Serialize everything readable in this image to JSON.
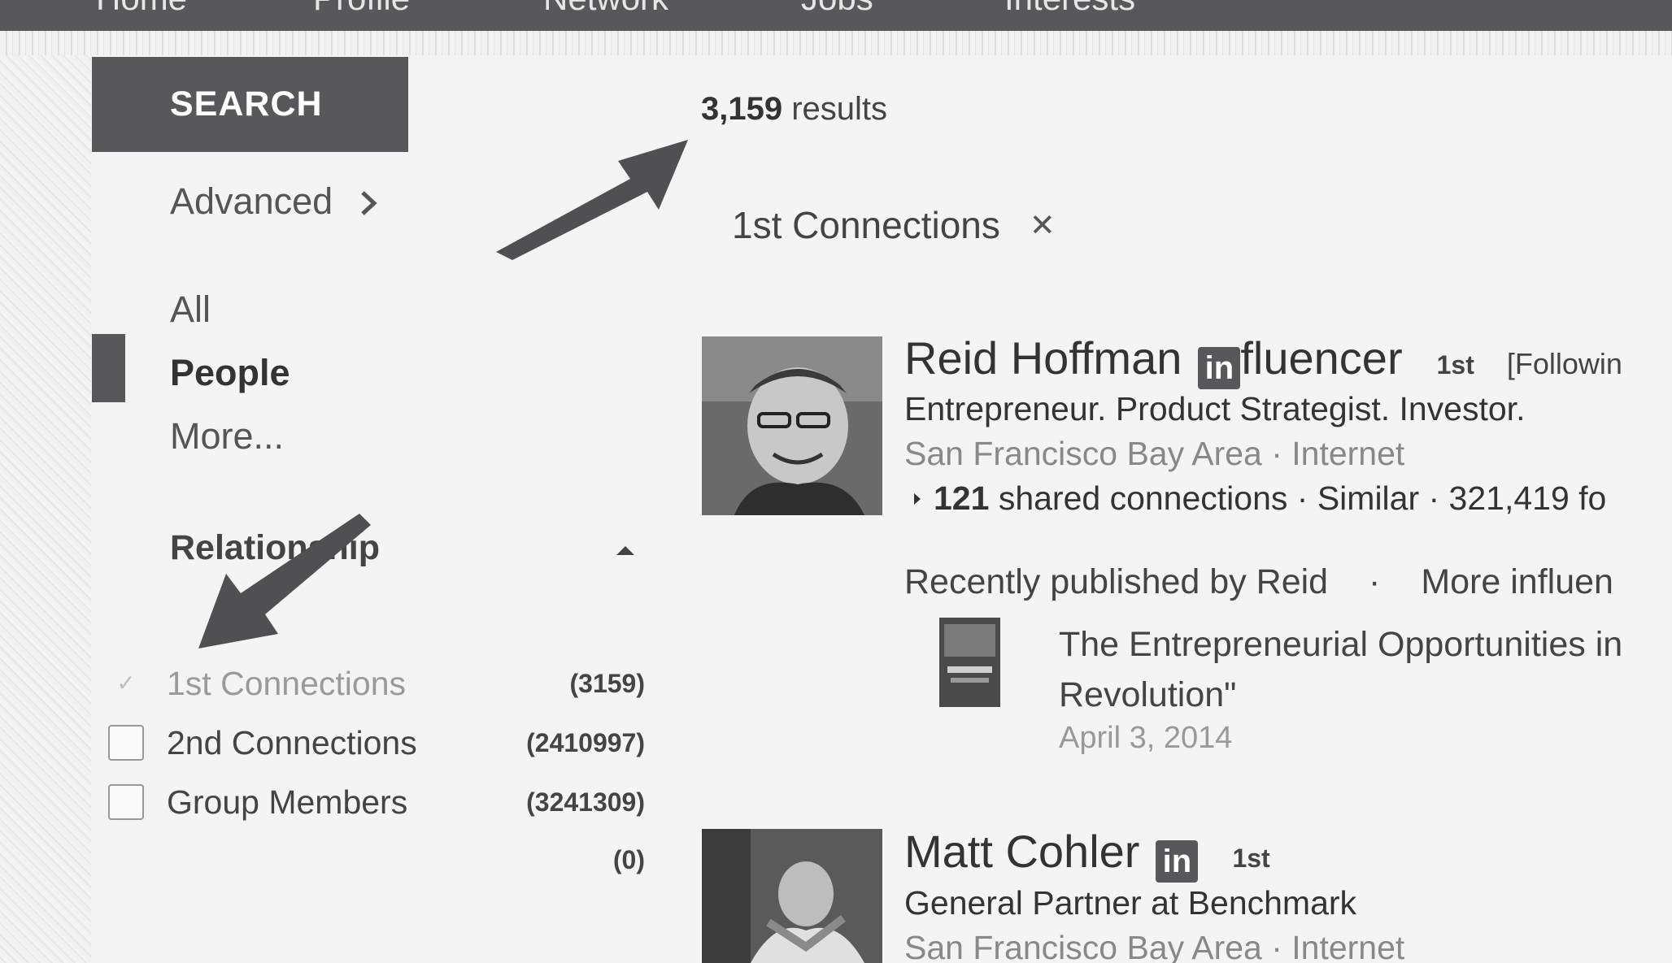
{
  "nav": {
    "items": [
      "Home",
      "Profile",
      "Network",
      "Jobs",
      "Interests"
    ]
  },
  "sidebar": {
    "search_label": "SEARCH",
    "advanced_label": "Advanced",
    "categories": [
      "All",
      "People",
      "More..."
    ],
    "relationship": {
      "title": "Relationship",
      "facets": [
        {
          "label": "1st Connections",
          "count": "(3159)",
          "checked": true
        },
        {
          "label": "2nd Connections",
          "count": "(2410997)",
          "checked": false
        },
        {
          "label": "Group Members",
          "count": "(3241309)",
          "checked": false
        }
      ],
      "extra_count": "(0)"
    }
  },
  "results": {
    "count": "3,159",
    "count_suffix": "results",
    "active_filter": "1st Connections",
    "people": [
      {
        "name": "Reid Hoffman",
        "influencer_badge": "in",
        "influencer_text": "fluencer",
        "degree": "1st",
        "following": "[Followin",
        "headline": "Entrepreneur. Product Strategist. Investor.",
        "location": "San Francisco Bay Area · Internet",
        "shared_count": "121",
        "shared_suffix": "shared connections · Similar · 321,419 fo",
        "recent_label": "Recently published by Reid",
        "recent_sep": "·",
        "more_influencers": "More influen",
        "article_title_line1": "The Entrepreneurial Opportunities in",
        "article_title_line2": "Revolution\"",
        "article_date": "April 3, 2014"
      },
      {
        "name": "Matt Cohler",
        "influencer_badge": "in",
        "degree": "1st",
        "headline": "General Partner at Benchmark",
        "location": "San Francisco Bay Area · Internet"
      }
    ]
  },
  "colors": {
    "dark": "#58585a",
    "text": "#3a3a3a",
    "muted": "#888888"
  }
}
